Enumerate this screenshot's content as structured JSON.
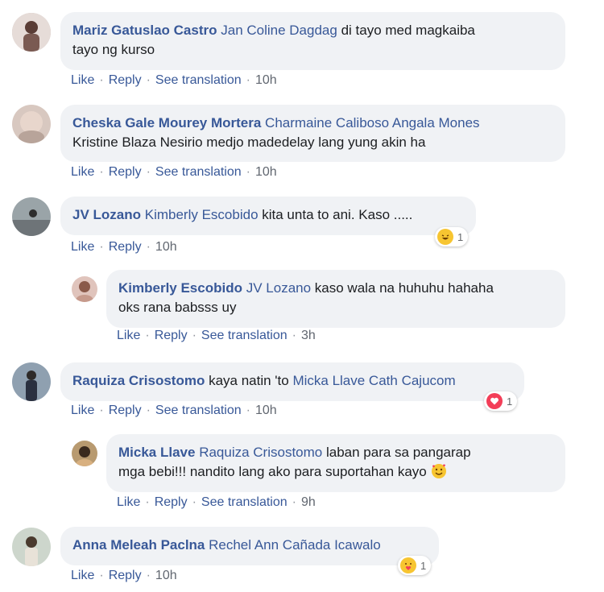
{
  "actions": {
    "like": "Like",
    "reply": "Reply",
    "see_translation": "See translation"
  },
  "comments": [
    {
      "author": "Mariz Gatuslao Castro",
      "tags": "Jan Coline Dagdag",
      "text_line1": " di tayo med magkaiba",
      "text_line2": "tayo ng kurso",
      "time": "10h"
    },
    {
      "author": "Cheska Gale Mourey Mortera",
      "tags": "Charmaine Caliboso Angala Mones",
      "text_line1": "",
      "tags2": "Kristine Blaza Nesirio",
      "text_line2": " medjo madedelay lang yung akin ha",
      "time": "10h"
    },
    {
      "author": "JV Lozano",
      "tags": "Kimberly Escobido",
      "text_line1": " kita unta to ani. Kaso .....",
      "time": "10h",
      "reaction_count": "1",
      "reaction": "haha"
    },
    {
      "author": "Kimberly Escobido",
      "tags": "JV Lozano",
      "text_line1": " kaso wala na huhuhu hahaha",
      "text_line2": "oks rana babsss uy",
      "time": "3h"
    },
    {
      "author": "Raquiza Crisostomo",
      "text_pre": " kaya natin 'to ",
      "tags": "Micka Llave Cath Cajucom",
      "time": "10h",
      "reaction_count": "1",
      "reaction": "love"
    },
    {
      "author": "Micka Llave",
      "tags": "Raquiza Crisostomo",
      "text_line1": " laban para sa pangarap",
      "text_line2": "mga bebi!!! nandito lang ako para suportahan kayo",
      "time": "9h"
    },
    {
      "author": "Anna Meleah Paclna",
      "tags": "Rechel Ann Cañada Icawalo",
      "time": "10h",
      "reaction_count": "1",
      "reaction": "care"
    }
  ],
  "colors": {
    "link": "#385898",
    "bubble": "#f0f2f5",
    "muted": "#616770"
  }
}
